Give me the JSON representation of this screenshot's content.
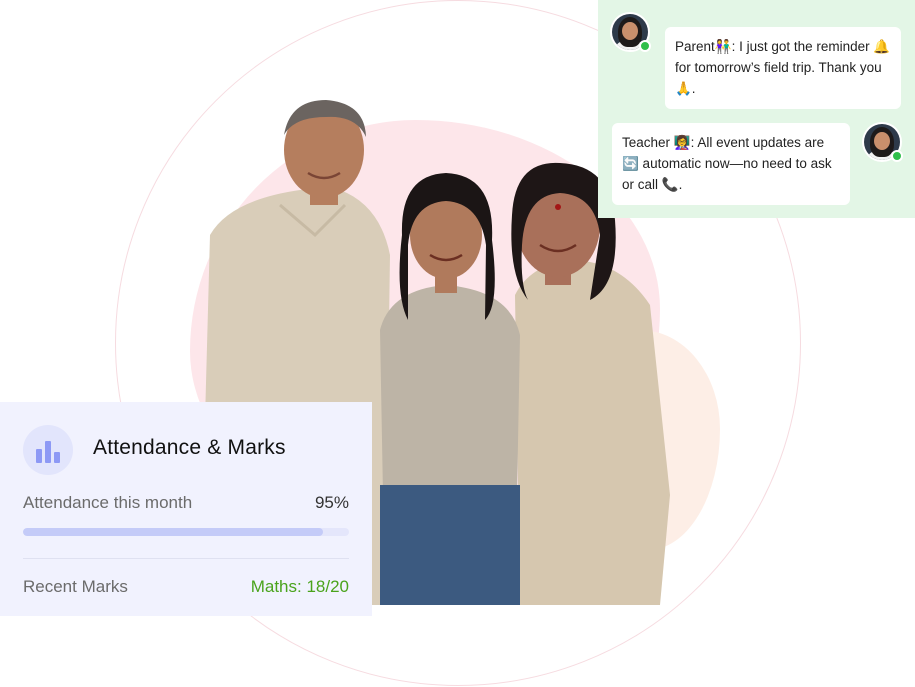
{
  "chat": {
    "parent_message": "Parent👫: I just got the reminder 🔔 for tomorrow’s field trip. Thank you 🙏.",
    "teacher_message": "Teacher 👩‍🏫: All event updates are 🔄 automatic now—no need to ask or call 📞."
  },
  "card": {
    "title": "Attendance & Marks",
    "icon": "bar-chart-icon",
    "attendance_label": "Attendance this month",
    "attendance_value": "95%",
    "attendance_progress": 0.92,
    "marks_label": "Recent Marks",
    "marks_value": "Maths: 18/20"
  },
  "colors": {
    "chat_panel_bg": "#e3f6e6",
    "card_bg": "#f1f2fe",
    "marks_green": "#4aa31c",
    "online_green": "#2fbf4a",
    "accent_periwinkle": "#8d99f5"
  }
}
